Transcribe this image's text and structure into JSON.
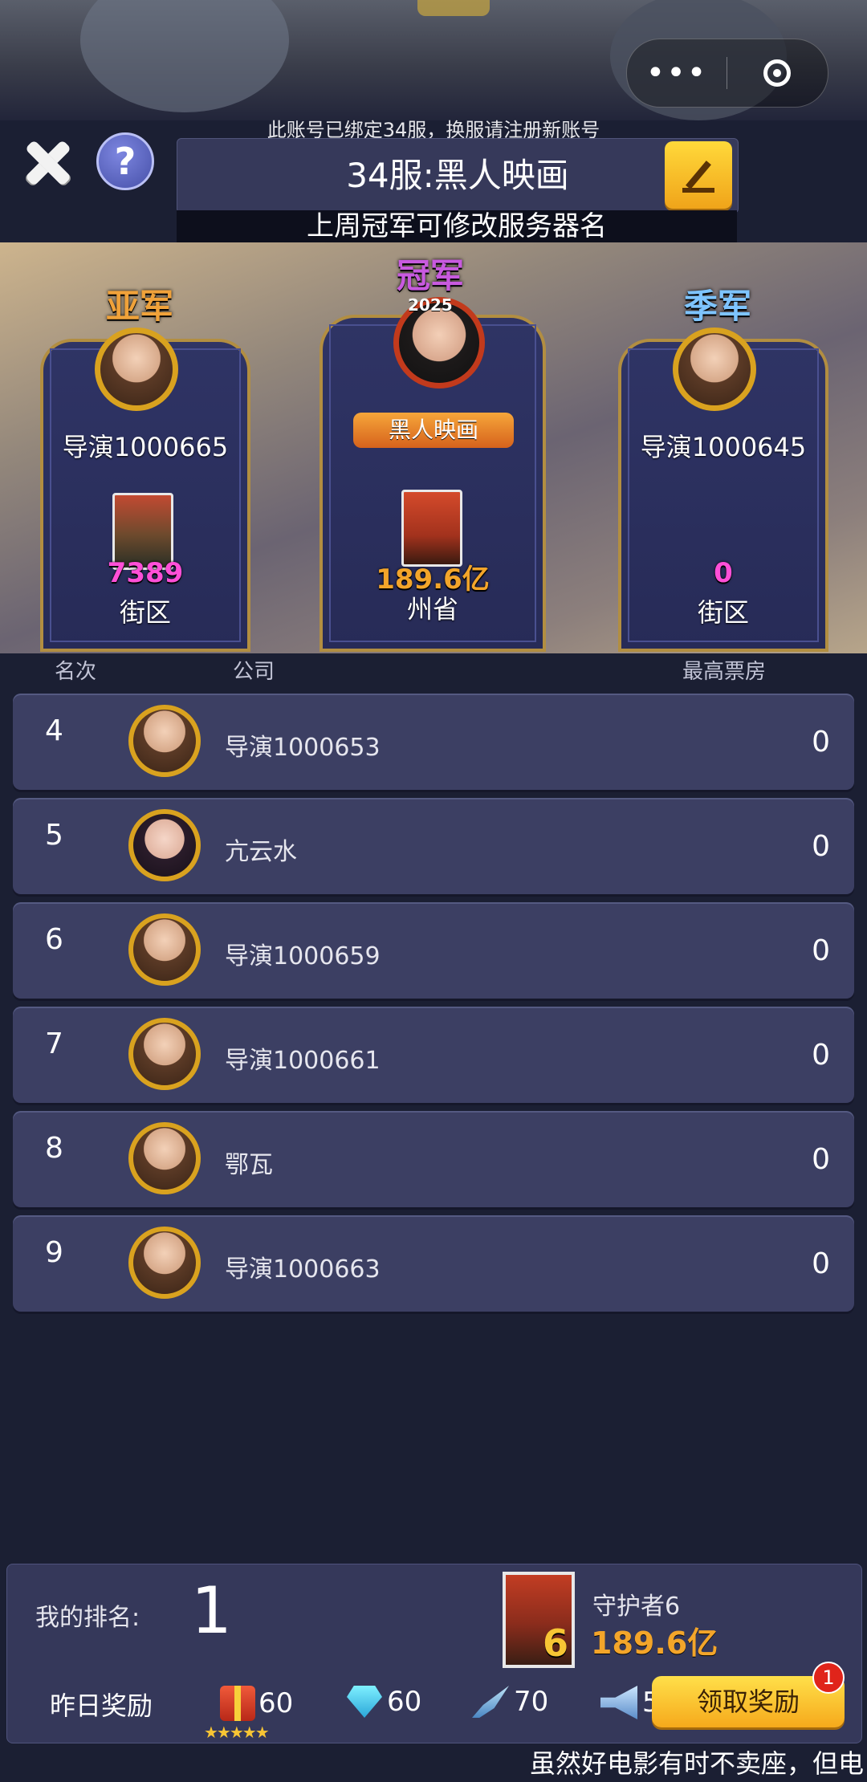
{
  "header": {
    "capsule_more": "•••",
    "notice": "此账号已绑定34服，换服请注册新账号",
    "help_label": "?",
    "server_name": "34服:黑人映画",
    "hint": "上周冠军可修改服务器名"
  },
  "podium": {
    "second": {
      "title": "亚军",
      "name": "导演1000665",
      "value": "7389",
      "region": "街区"
    },
    "first": {
      "title": "冠军",
      "badge_year": "2025",
      "company": "黑人映画",
      "value": "189.6亿",
      "region": "州省"
    },
    "third": {
      "title": "季军",
      "name": "导演1000645",
      "value": "0",
      "region": "街区"
    }
  },
  "columns": {
    "rank": "名次",
    "company": "公司",
    "box_office": "最高票房"
  },
  "rows": [
    {
      "rank": "4",
      "company": "导演1000653",
      "score": "0"
    },
    {
      "rank": "5",
      "company": "亢云水",
      "score": "0"
    },
    {
      "rank": "6",
      "company": "导演1000659",
      "score": "0"
    },
    {
      "rank": "7",
      "company": "导演1000661",
      "score": "0"
    },
    {
      "rank": "8",
      "company": "鄂瓦",
      "score": "0"
    },
    {
      "rank": "9",
      "company": "导演1000663",
      "score": "0"
    }
  ],
  "my": {
    "label": "我的排名:",
    "rank": "1",
    "poster_number": "6",
    "movie": "守护者6",
    "box_office": "189.6亿"
  },
  "rewards": {
    "label": "昨日奖励",
    "gift": "60",
    "gem": "60",
    "pen": "70",
    "horn": "5",
    "stars": "★★★★★",
    "claim": "领取奖励",
    "badge": "1"
  },
  "ticker": "虽然好电影有时不卖座，但电"
}
